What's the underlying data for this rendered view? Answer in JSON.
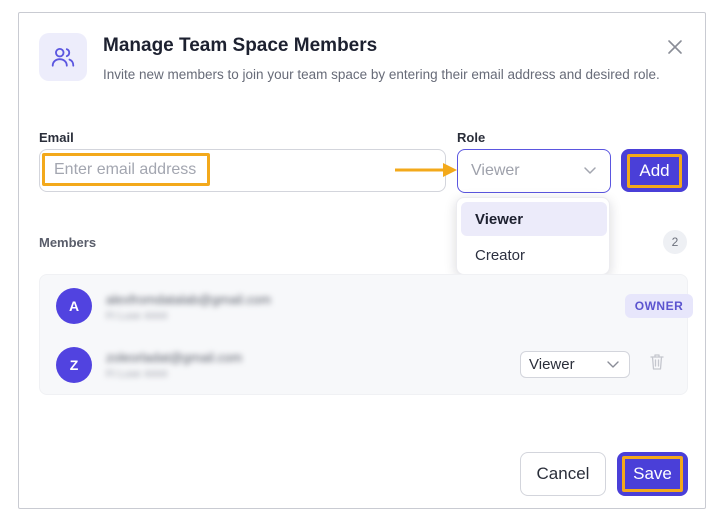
{
  "dialog": {
    "title": "Manage Team Space Members",
    "subtitle": "Invite new members to join your team space by entering their email address and desired role.",
    "header_icon": "users-icon",
    "close_icon": "close-icon"
  },
  "form": {
    "email_label": "Email",
    "email_placeholder": "Enter email address",
    "email_value": "",
    "role_label": "Role",
    "role_placeholder": "Viewer",
    "add_label": "Add"
  },
  "role_dropdown": {
    "options": [
      "Viewer",
      "Creator"
    ],
    "selected": "Viewer"
  },
  "members": {
    "label": "Members",
    "count": "2",
    "items": [
      {
        "initial": "A",
        "email": "alexfromdatalab@gmail.com",
        "subtitle": "Ft Luse 4444",
        "badge": "OWNER"
      },
      {
        "initial": "Z",
        "email": "zoleorladat@gmail.com",
        "subtitle": "Ft Luse 4444",
        "role": "Viewer"
      }
    ]
  },
  "footer": {
    "cancel_label": "Cancel",
    "save_label": "Save"
  },
  "colors": {
    "accent": "#4a3fd8",
    "highlight": "#f3a91b",
    "avatar": "#5143e0"
  }
}
